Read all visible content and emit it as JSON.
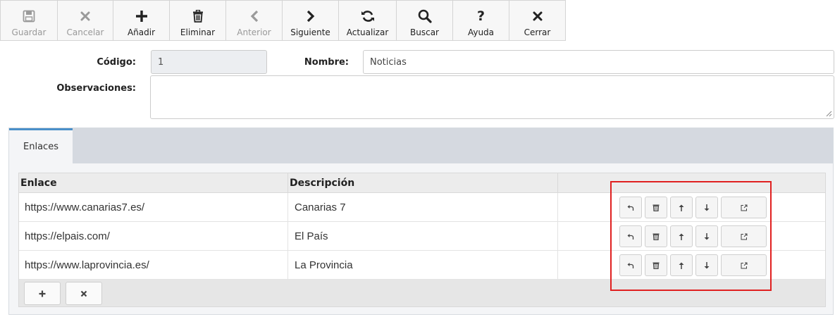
{
  "toolbar": {
    "buttons": [
      {
        "label": "Guardar",
        "icon": "save-icon",
        "enabled": false
      },
      {
        "label": "Cancelar",
        "icon": "close-icon",
        "enabled": false
      },
      {
        "label": "Añadir",
        "icon": "plus-icon",
        "enabled": true
      },
      {
        "label": "Eliminar",
        "icon": "trash-icon",
        "enabled": true
      },
      {
        "label": "Anterior",
        "icon": "chevron-left-icon",
        "enabled": false
      },
      {
        "label": "Siguiente",
        "icon": "chevron-right-icon",
        "enabled": true
      },
      {
        "label": "Actualizar",
        "icon": "refresh-icon",
        "enabled": true
      },
      {
        "label": "Buscar",
        "icon": "search-icon",
        "enabled": true
      },
      {
        "label": "Ayuda",
        "icon": "question-icon",
        "enabled": true
      },
      {
        "label": "Cerrar",
        "icon": "close-icon",
        "enabled": true
      }
    ]
  },
  "form": {
    "codigo_label": "Código:",
    "codigo_value": "1",
    "nombre_label": "Nombre:",
    "nombre_value": "Noticias",
    "observaciones_label": "Observaciones:",
    "observaciones_value": ""
  },
  "tabs": [
    {
      "label": "Enlaces",
      "active": true
    }
  ],
  "grid": {
    "headers": [
      "Enlace",
      "Descripción",
      ""
    ],
    "rows": [
      {
        "enlace": "https://www.canarias7.es/",
        "descripcion": "Canarias 7"
      },
      {
        "enlace": "https://elpais.com/",
        "descripcion": "El País"
      },
      {
        "enlace": "https://www.laprovincia.es/",
        "descripcion": "La Provincia"
      }
    ],
    "row_actions": [
      "undo-icon",
      "trash-icon",
      "arrow-up-icon",
      "arrow-down-icon",
      "external-link-icon"
    ],
    "footer_buttons": [
      "plus-icon",
      "close-icon"
    ]
  },
  "colors": {
    "tab_accent": "#4a8fc9",
    "highlight": "#e02020"
  }
}
